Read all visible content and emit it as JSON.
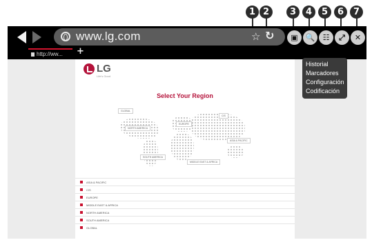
{
  "callouts": [
    "1",
    "2",
    "3",
    "4",
    "5",
    "6",
    "7"
  ],
  "browser": {
    "url": "www.lg.com",
    "tab_label": "http://ww...",
    "new_tab_label": "+",
    "icons": {
      "back": "back-icon",
      "forward": "forward-icon",
      "globe": "globe-icon",
      "bookmark": "bookmark-add-icon",
      "reload": "reload-icon",
      "multiview": "multiview-icon",
      "zoom": "zoom-icon",
      "more": "more-menu-icon",
      "fullscreen": "fullscreen-icon",
      "close": "close-icon"
    },
    "glyphs": {
      "bookmark": "☆",
      "reload": "↻",
      "multiview": "▣",
      "zoom": "🔍",
      "more": "☷",
      "fullscreen": "⤢",
      "close": "✕"
    }
  },
  "menu": {
    "items": [
      "Historial",
      "Marcadores",
      "Configuración",
      "Codificación"
    ]
  },
  "page": {
    "logo_text": "LG",
    "logo_tagline": "Life's Good",
    "title": "Select Your Region",
    "map_labels": [
      "GLOBAL",
      "NORTH AMERICA",
      "EUROPE",
      "CIS",
      "ASIA & PACIFIC",
      "SOUTH AMERICA",
      "MIDDLE EAST & AFRICA"
    ],
    "regions": [
      "ASIA & PACIFIC",
      "CIS",
      "EUROPE",
      "MIDDLE EAST & AFRICA",
      "NORTH AMERICA",
      "SOUTH AMERICA",
      "GLOBAL"
    ]
  },
  "colors": {
    "brand": "#b4123a",
    "chrome": "#000000",
    "menu_bg": "#3a3a3a"
  }
}
